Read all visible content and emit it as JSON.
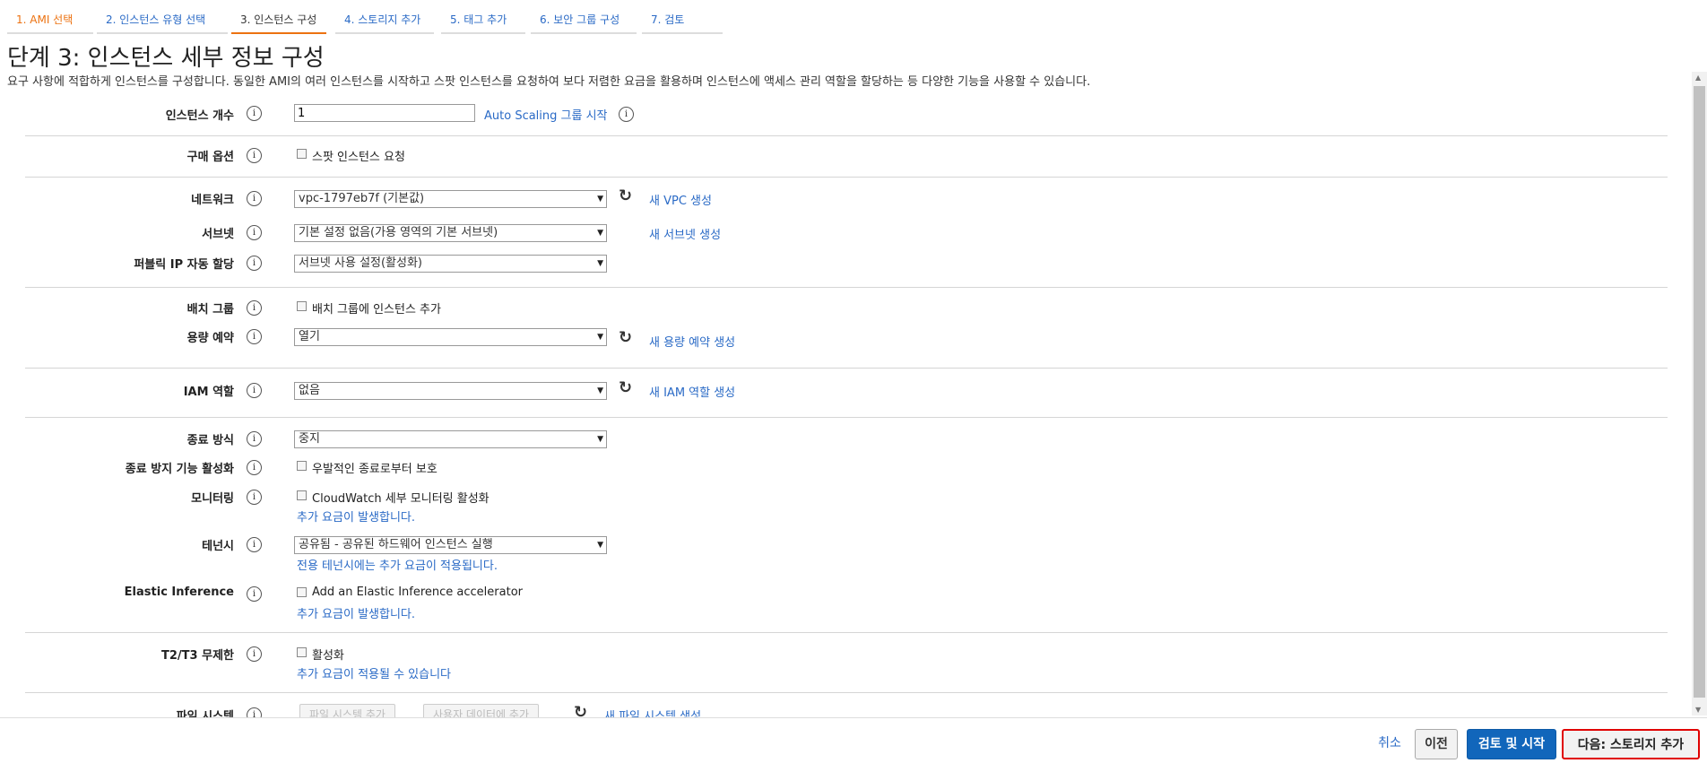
{
  "tabs": [
    "1. AMI 선택",
    "2. 인스턴스 유형 선택",
    "3. 인스턴스 구성",
    "4. 스토리지 추가",
    "5. 태그 추가",
    "6. 보안 그룹 구성",
    "7. 검토"
  ],
  "title": "단계 3: 인스턴스 세부 정보 구성",
  "description": "요구 사항에 적합하게 인스턴스를 구성합니다. 동일한 AMI의 여러 인스턴스를 시작하고 스팟 인스턴스를 요청하여 보다 저렴한 요금을 활용하며 인스턴스에 액세스 관리 역할을 할당하는 등 다양한 기능을 사용할 수 있습니다.",
  "info_glyph": "i",
  "arrow_glyph": "▼",
  "refresh_glyph": "↻",
  "form": {
    "instance_count": {
      "label": "인스턴스 개수",
      "value": "1",
      "link": "Auto Scaling 그룹 시작"
    },
    "purchase": {
      "label": "구매 옵션",
      "checkbox": "스팟 인스턴스 요청"
    },
    "network": {
      "label": "네트워크",
      "value": "vpc-1797eb7f (기본값)",
      "link": "새 VPC 생성"
    },
    "subnet": {
      "label": "서브넷",
      "value": "기본 설정 없음(가용 영역의 기본 서브넷)",
      "link": "새 서브넷 생성"
    },
    "public_ip": {
      "label": "퍼블릭 IP 자동 할당",
      "value": "서브넷 사용 설정(활성화)"
    },
    "placement": {
      "label": "배치 그룹",
      "checkbox": "배치 그룹에 인스턴스 추가"
    },
    "capacity": {
      "label": "용량 예약",
      "value": "열기",
      "link": "새 용량 예약 생성"
    },
    "iam": {
      "label": "IAM 역할",
      "value": "없음",
      "link": "새 IAM 역할 생성"
    },
    "shutdown": {
      "label": "종료 방식",
      "value": "중지"
    },
    "termination": {
      "label": "종료 방지 기능 활성화",
      "checkbox": "우발적인 종료로부터 보호"
    },
    "monitoring": {
      "label": "모니터링",
      "checkbox": "CloudWatch 세부 모니터링 활성화",
      "note": "추가 요금이 발생합니다."
    },
    "tenancy": {
      "label": "테넌시",
      "value": "공유됨 - 공유된 하드웨어 인스턴스 실행",
      "note": "전용 테넌시에는 추가 요금이 적용됩니다."
    },
    "elastic": {
      "label": "Elastic Inference",
      "checkbox": "Add an Elastic Inference accelerator",
      "note": "추가 요금이 발생합니다."
    },
    "t2t3": {
      "label": "T2/T3 무제한",
      "checkbox": "활성화",
      "note": "추가 요금이 적용될 수 있습니다"
    },
    "filesystem": {
      "label": "파일 시스템",
      "btn_add": "파일 시스템 추가",
      "btn_userdata": "사용자 데이터에 추가",
      "link": "새 파일 시스템 생성"
    }
  },
  "footer": {
    "cancel": "취소",
    "prev": "이전",
    "review": "검토 및 시작",
    "next": "다음: 스토리지 추가"
  },
  "colors": {
    "link": "#2a6ac6",
    "accent": "#ec7211",
    "primary": "#1166bb",
    "highlight": "#e00000"
  }
}
